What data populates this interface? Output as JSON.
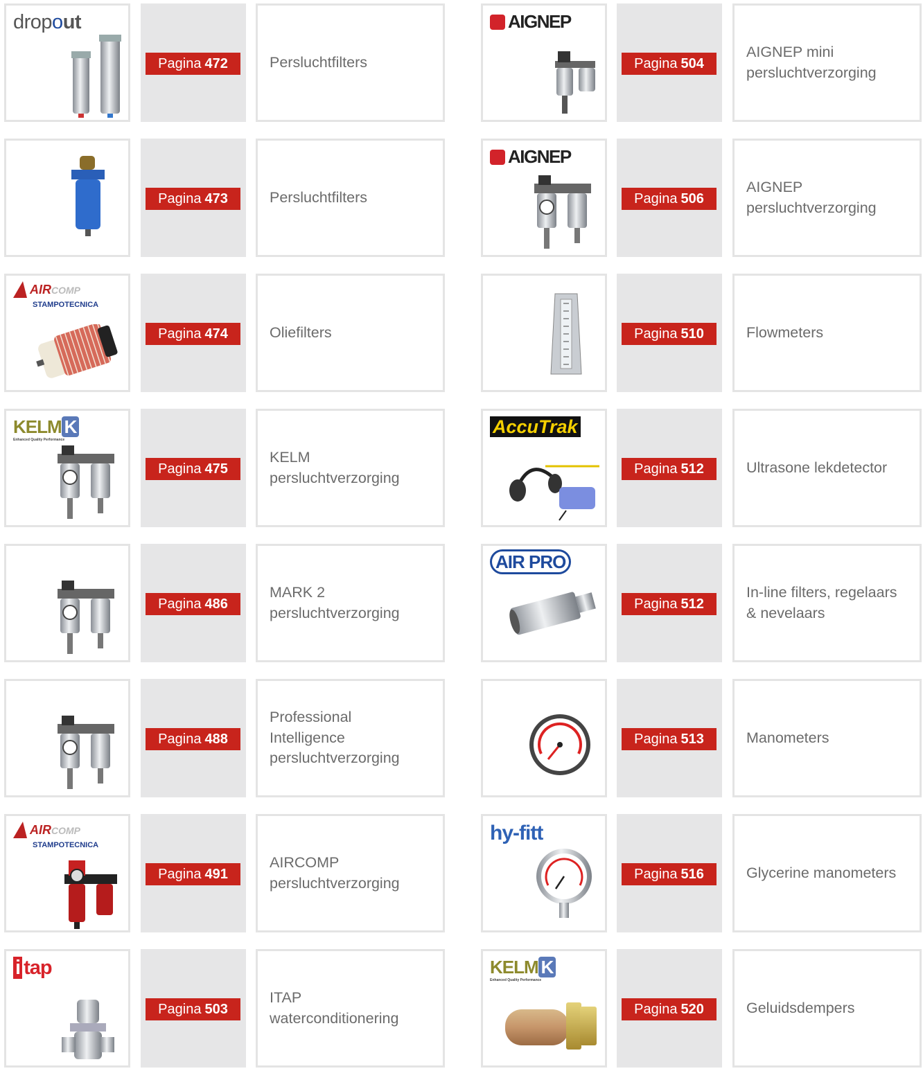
{
  "page_prefix": "Pagina",
  "left": [
    {
      "logo": "dropout",
      "product": "cylinder-filter-icon",
      "page": "472",
      "desc": "Persluchtfilters"
    },
    {
      "logo": "",
      "product": "blue-filter-icon",
      "page": "473",
      "desc": "Persluchtfilters"
    },
    {
      "logo": "AIR COMP STAMPOTECNICA",
      "product": "oil-filter-element-icon",
      "page": "474",
      "desc": "Oliefilters"
    },
    {
      "logo": "KELMK",
      "product": "frl-unit-icon",
      "page": "475",
      "desc": "KELM\npersluchtverzorging"
    },
    {
      "logo": "",
      "product": "frl-unit-icon",
      "page": "486",
      "desc": "MARK 2\npersluchtverzorging"
    },
    {
      "logo": "",
      "product": "frl-unit-icon",
      "page": "488",
      "desc": "Professional\nIntelligence\npersluchtverzorging"
    },
    {
      "logo": "AIR COMP STAMPOTECNICA",
      "product": "frl-unit-red-icon",
      "page": "491",
      "desc": "AIRCOMP\npersluchtverzorging"
    },
    {
      "logo": "itap",
      "product": "pressure-reducer-valve-icon",
      "page": "503",
      "desc": "ITAP\nwaterconditionering"
    }
  ],
  "right": [
    {
      "logo": "AIGNEP",
      "product": "frl-mini-icon",
      "page": "504",
      "desc": "AIGNEP mini\npersluchtverzorging"
    },
    {
      "logo": "AIGNEP",
      "product": "frl-unit-icon",
      "page": "506",
      "desc": "AIGNEP\npersluchtverzorging"
    },
    {
      "logo": "",
      "product": "flowmeter-icon",
      "page": "510",
      "desc": "Flowmeters"
    },
    {
      "logo": "AccuTrak",
      "product": "leak-detector-headphones-icon",
      "page": "512",
      "desc": "Ultrasone lekdetector"
    },
    {
      "logo": "AIRPRO",
      "product": "inline-filter-icon",
      "page": "512",
      "desc": "In-line filters, regelaars\n& nevelaars"
    },
    {
      "logo": "",
      "product": "pressure-gauge-icon",
      "page": "513",
      "desc": "Manometers"
    },
    {
      "logo": "hyfitt",
      "product": "glycerine-gauge-icon",
      "page": "516",
      "desc": "Glycerine manometers"
    },
    {
      "logo": "KELMK",
      "product": "silencer-icon",
      "page": "520",
      "desc": "Geluidsdempers"
    }
  ]
}
